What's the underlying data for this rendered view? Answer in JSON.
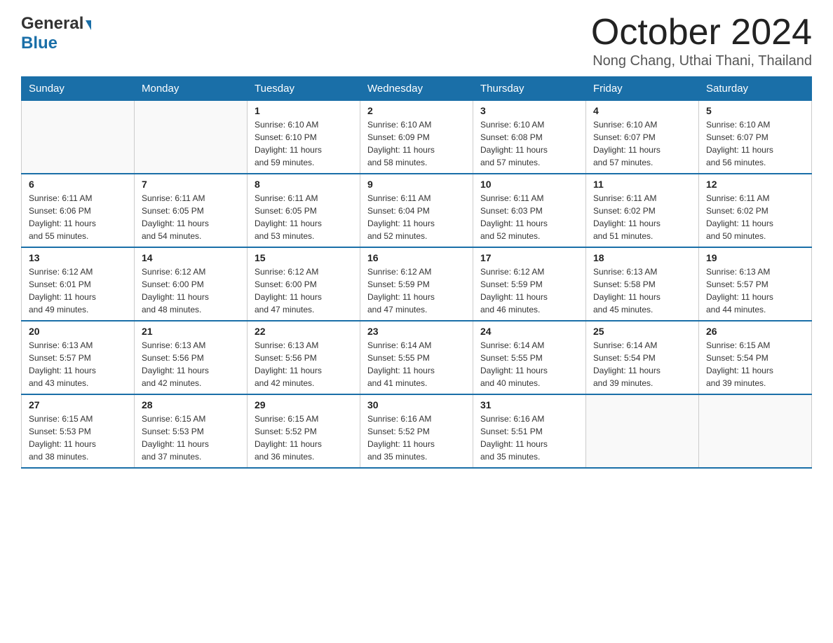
{
  "logo": {
    "general": "General",
    "blue": "Blue"
  },
  "title": {
    "month_year": "October 2024",
    "location": "Nong Chang, Uthai Thani, Thailand"
  },
  "days_header": [
    "Sunday",
    "Monday",
    "Tuesday",
    "Wednesday",
    "Thursday",
    "Friday",
    "Saturday"
  ],
  "weeks": [
    [
      {
        "day": "",
        "info": ""
      },
      {
        "day": "",
        "info": ""
      },
      {
        "day": "1",
        "info": "Sunrise: 6:10 AM\nSunset: 6:10 PM\nDaylight: 11 hours\nand 59 minutes."
      },
      {
        "day": "2",
        "info": "Sunrise: 6:10 AM\nSunset: 6:09 PM\nDaylight: 11 hours\nand 58 minutes."
      },
      {
        "day": "3",
        "info": "Sunrise: 6:10 AM\nSunset: 6:08 PM\nDaylight: 11 hours\nand 57 minutes."
      },
      {
        "day": "4",
        "info": "Sunrise: 6:10 AM\nSunset: 6:07 PM\nDaylight: 11 hours\nand 57 minutes."
      },
      {
        "day": "5",
        "info": "Sunrise: 6:10 AM\nSunset: 6:07 PM\nDaylight: 11 hours\nand 56 minutes."
      }
    ],
    [
      {
        "day": "6",
        "info": "Sunrise: 6:11 AM\nSunset: 6:06 PM\nDaylight: 11 hours\nand 55 minutes."
      },
      {
        "day": "7",
        "info": "Sunrise: 6:11 AM\nSunset: 6:05 PM\nDaylight: 11 hours\nand 54 minutes."
      },
      {
        "day": "8",
        "info": "Sunrise: 6:11 AM\nSunset: 6:05 PM\nDaylight: 11 hours\nand 53 minutes."
      },
      {
        "day": "9",
        "info": "Sunrise: 6:11 AM\nSunset: 6:04 PM\nDaylight: 11 hours\nand 52 minutes."
      },
      {
        "day": "10",
        "info": "Sunrise: 6:11 AM\nSunset: 6:03 PM\nDaylight: 11 hours\nand 52 minutes."
      },
      {
        "day": "11",
        "info": "Sunrise: 6:11 AM\nSunset: 6:02 PM\nDaylight: 11 hours\nand 51 minutes."
      },
      {
        "day": "12",
        "info": "Sunrise: 6:11 AM\nSunset: 6:02 PM\nDaylight: 11 hours\nand 50 minutes."
      }
    ],
    [
      {
        "day": "13",
        "info": "Sunrise: 6:12 AM\nSunset: 6:01 PM\nDaylight: 11 hours\nand 49 minutes."
      },
      {
        "day": "14",
        "info": "Sunrise: 6:12 AM\nSunset: 6:00 PM\nDaylight: 11 hours\nand 48 minutes."
      },
      {
        "day": "15",
        "info": "Sunrise: 6:12 AM\nSunset: 6:00 PM\nDaylight: 11 hours\nand 47 minutes."
      },
      {
        "day": "16",
        "info": "Sunrise: 6:12 AM\nSunset: 5:59 PM\nDaylight: 11 hours\nand 47 minutes."
      },
      {
        "day": "17",
        "info": "Sunrise: 6:12 AM\nSunset: 5:59 PM\nDaylight: 11 hours\nand 46 minutes."
      },
      {
        "day": "18",
        "info": "Sunrise: 6:13 AM\nSunset: 5:58 PM\nDaylight: 11 hours\nand 45 minutes."
      },
      {
        "day": "19",
        "info": "Sunrise: 6:13 AM\nSunset: 5:57 PM\nDaylight: 11 hours\nand 44 minutes."
      }
    ],
    [
      {
        "day": "20",
        "info": "Sunrise: 6:13 AM\nSunset: 5:57 PM\nDaylight: 11 hours\nand 43 minutes."
      },
      {
        "day": "21",
        "info": "Sunrise: 6:13 AM\nSunset: 5:56 PM\nDaylight: 11 hours\nand 42 minutes."
      },
      {
        "day": "22",
        "info": "Sunrise: 6:13 AM\nSunset: 5:56 PM\nDaylight: 11 hours\nand 42 minutes."
      },
      {
        "day": "23",
        "info": "Sunrise: 6:14 AM\nSunset: 5:55 PM\nDaylight: 11 hours\nand 41 minutes."
      },
      {
        "day": "24",
        "info": "Sunrise: 6:14 AM\nSunset: 5:55 PM\nDaylight: 11 hours\nand 40 minutes."
      },
      {
        "day": "25",
        "info": "Sunrise: 6:14 AM\nSunset: 5:54 PM\nDaylight: 11 hours\nand 39 minutes."
      },
      {
        "day": "26",
        "info": "Sunrise: 6:15 AM\nSunset: 5:54 PM\nDaylight: 11 hours\nand 39 minutes."
      }
    ],
    [
      {
        "day": "27",
        "info": "Sunrise: 6:15 AM\nSunset: 5:53 PM\nDaylight: 11 hours\nand 38 minutes."
      },
      {
        "day": "28",
        "info": "Sunrise: 6:15 AM\nSunset: 5:53 PM\nDaylight: 11 hours\nand 37 minutes."
      },
      {
        "day": "29",
        "info": "Sunrise: 6:15 AM\nSunset: 5:52 PM\nDaylight: 11 hours\nand 36 minutes."
      },
      {
        "day": "30",
        "info": "Sunrise: 6:16 AM\nSunset: 5:52 PM\nDaylight: 11 hours\nand 35 minutes."
      },
      {
        "day": "31",
        "info": "Sunrise: 6:16 AM\nSunset: 5:51 PM\nDaylight: 11 hours\nand 35 minutes."
      },
      {
        "day": "",
        "info": ""
      },
      {
        "day": "",
        "info": ""
      }
    ]
  ]
}
